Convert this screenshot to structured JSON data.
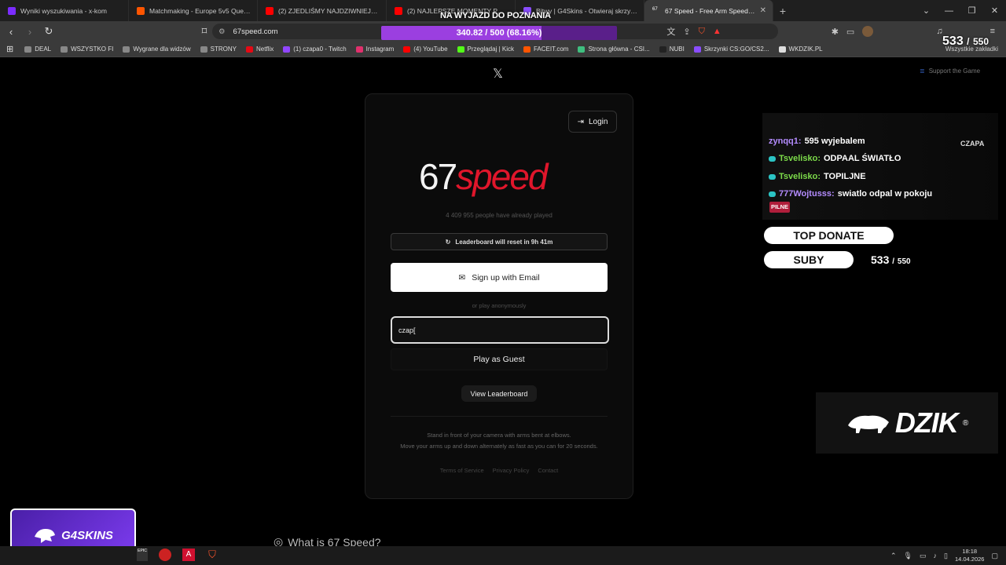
{
  "browser": {
    "tabs": [
      {
        "label": "Wyniki wyszukiwania - x-kom",
        "color": "#7b2cff"
      },
      {
        "label": "Matchmaking - Europe 5v5 Queue - FACEIT",
        "color": "#ff5500"
      },
      {
        "label": "(2) ZJEDLIŚMY NAJDZIWNIEJSZĄ PIZZĘ",
        "color": "#ff0000"
      },
      {
        "label": "(2) NAJLEPSZE MOMENTY POLSKIEGO",
        "color": "#ff0000"
      },
      {
        "label": "Bitwy | G4Skins - Otwieraj skrzynki CS2",
        "color": "#8a4dff"
      },
      {
        "label": "67 Speed - Free Arm Speed Challenge",
        "color": "#333333",
        "active": true
      }
    ],
    "tab_favicon_active": "67",
    "new_tab": "+",
    "url": "67speed.com",
    "bookmarks": [
      {
        "label": "DEAL",
        "color": "#888888"
      },
      {
        "label": "WSZYSTKO FI",
        "color": "#888888"
      },
      {
        "label": "Wygrane dla widzów",
        "color": "#888888"
      },
      {
        "label": "STRONY",
        "color": "#888888"
      },
      {
        "label": "Netflix",
        "color": "#e50914"
      },
      {
        "label": "(1) czapa0 - Twitch",
        "color": "#9146ff"
      },
      {
        "label": "Instagram",
        "color": "#e1306c"
      },
      {
        "label": "(4) YouTube",
        "color": "#ff0000"
      },
      {
        "label": "Przeglądaj | Kick",
        "color": "#53fc18"
      },
      {
        "label": "FACEIT.com",
        "color": "#ff5500"
      },
      {
        "label": "Strona główna - CSI...",
        "color": "#3fbf7f"
      },
      {
        "label": "NUBI",
        "color": "#222222"
      },
      {
        "label": "Skrzynki CS:GO/CS2...",
        "color": "#8a4dff"
      },
      {
        "label": "WKDZIK.PL",
        "color": "#dddddd"
      }
    ],
    "bookmarks_all": "Wszystkie zakładki"
  },
  "stream_overlay": {
    "goal_title": "NA WYJAZD DO POZNANIA",
    "goal_progress": 0.6816,
    "goal_text": "340.82 / 500 (68.16%)",
    "subs_current": "533",
    "subs_sep": "/",
    "subs_target": "550",
    "chat": [
      {
        "user": "zynqq1:",
        "message": "595 wyjebalem",
        "user_color": "#b48cff"
      },
      {
        "user": "Tsvelisko:",
        "message": "ODPAAL ŚWIATŁO",
        "user_color": "#7ddc4a"
      },
      {
        "user": "Tsvelisko:",
        "message": "TOPILJNE",
        "user_color": "#7ddc4a"
      },
      {
        "user": "777Wojtusss:",
        "message": "swiatlo odpal w pokoju",
        "user_color": "#b48cff"
      }
    ],
    "chat_tag": "CZAPA",
    "pilne": "PILNE",
    "top_donate": "TOP DONATE",
    "suby": "SUBY",
    "dzik_logo": "DZIK",
    "dzik_reg": "®",
    "g4skins_logo": "G4SKINS"
  },
  "page": {
    "x_icon": "𝕏",
    "support_label": "Support the Game",
    "login_label": "Login",
    "logo_number": "67",
    "logo_word": "speed",
    "played_count": "4 409 955 people have already played",
    "reset_notice": "Leaderboard will reset in 9h 41m",
    "signup_label": "Sign up with Email",
    "anon_label": "or play anonymously",
    "name_value": "czap[",
    "guest_label": "Play as Guest",
    "leaderboard_label": "View Leaderboard",
    "instructions_1": "Stand in front of your camera with arms bent at elbows.",
    "instructions_2": "Move your arms up and down alternately as fast as you can for 20 seconds.",
    "footer": {
      "terms": "Terms of Service",
      "privacy": "Privacy Policy",
      "contact": "Contact"
    },
    "what_is": "What is 67 Speed?",
    "brand_red": "#e0162b"
  },
  "taskbar": {
    "time": "18:18",
    "date": "14.04.2026"
  }
}
